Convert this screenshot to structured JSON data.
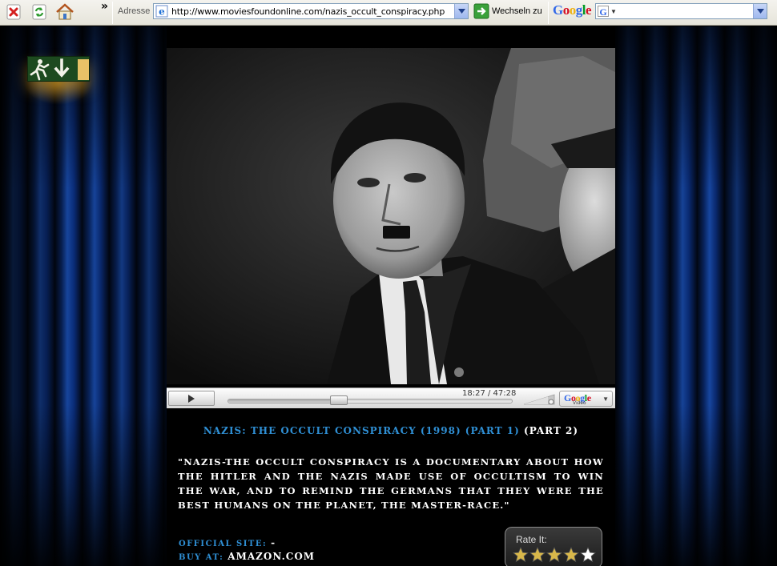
{
  "browser": {
    "toolbar_overflow": "»",
    "address_label": "Adresse",
    "url": "http://www.moviesfoundonline.com/nazis_occult_conspiracy.php",
    "go_label": "Wechseln zu",
    "search_brand": "Google",
    "search_box_glyph": "G"
  },
  "player": {
    "time_display": "18:27 / 47:28",
    "progress_fraction": 0.39,
    "google_video_word": "Google",
    "google_video_sub": "Video"
  },
  "content": {
    "title_link": "NAZIS: THE OCCULT CONSPIRACY (1998) (PART 1)",
    "title_part2": "(PART 2)",
    "description": "\"NAZIS-THE OCCULT CONSPIRACY IS A DOCUMENTARY ABOUT HOW THE HITLER AND THE NAZIS MADE USE OF OCCULTISM TO WIN THE WAR, AND TO REMIND THE GERMANS THAT THEY WERE THE BEST HUMANS ON THE PLANET, THE MASTER-RACE.\"",
    "official_site_label": "OFFICIAL SITE:",
    "official_site_value": "-",
    "buy_at_label": "BUY AT:",
    "buy_at_value": "AMAZON.COM"
  },
  "rating": {
    "label": "Rate It:",
    "stars_filled": 4,
    "stars_total": 5,
    "star_color": "#d9b84a"
  },
  "colors": {
    "link_blue": "#2f8fd4",
    "curtain_blue": "#1d58c8",
    "exit_green": "#1d4a1f"
  }
}
